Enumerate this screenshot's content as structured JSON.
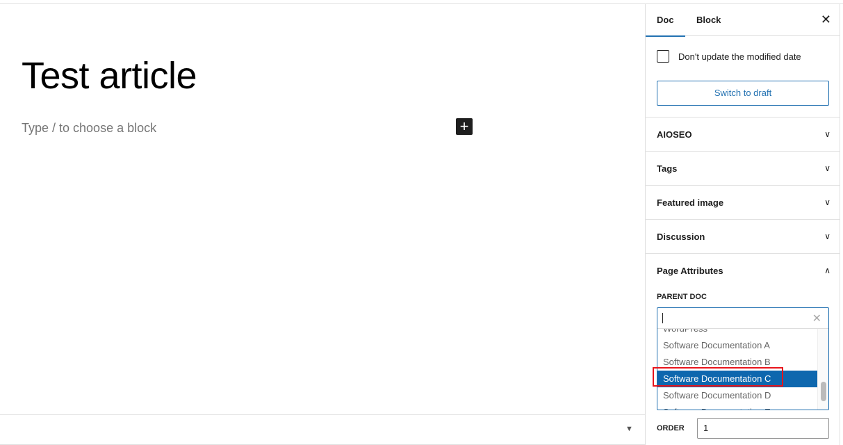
{
  "editor": {
    "title": "Test article",
    "placeholder": "Type / to choose a block",
    "inserter_icon": "plus-icon",
    "footer_toggle_icon": "chevron-down-icon"
  },
  "sidebar": {
    "tabs": [
      {
        "label": "Doc",
        "active": true
      },
      {
        "label": "Block",
        "active": false
      }
    ],
    "close_icon": "close-icon",
    "modified_date_label": "Don't update the modified date",
    "modified_date_checked": false,
    "switch_draft_label": "Switch to draft",
    "panels": [
      {
        "label": "AIOSEO",
        "expanded": false
      },
      {
        "label": "Tags",
        "expanded": false
      },
      {
        "label": "Featured image",
        "expanded": false
      },
      {
        "label": "Discussion",
        "expanded": false
      },
      {
        "label": "Page Attributes",
        "expanded": true
      }
    ],
    "page_attributes": {
      "parent_label": "PARENT DOC",
      "search_value": "",
      "options": [
        "WordPress",
        "Software Documentation A",
        "Software Documentation B",
        "Software Documentation C",
        "Software Documentation D",
        "Software Documentation E"
      ],
      "highlighted": "Software Documentation C",
      "order_label": "ORDER",
      "order_value": "1"
    }
  },
  "colors": {
    "accent": "#2271b1",
    "selected": "#0e67ae",
    "annotation": "#e8141b"
  }
}
